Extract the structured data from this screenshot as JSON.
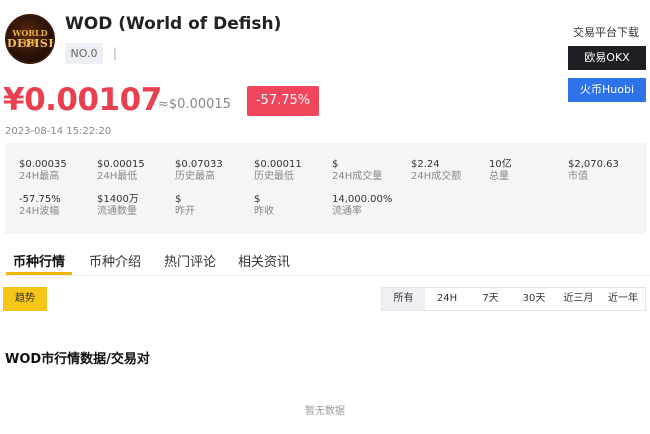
{
  "coin": {
    "logo_text_line1": "WORLD OF",
    "logo_text_line2": "DEFISH",
    "title": "WOD (World of Defish)",
    "rank": "NO.0",
    "separator": "|"
  },
  "download": {
    "title": "交易平台下载",
    "okx_label": "欧易OKX",
    "huobi_label": "火币Huobi"
  },
  "price": {
    "cny": "¥0.00107",
    "usd": "≈$0.00015",
    "change": "-57.75%",
    "timestamp": "2023-08-14 15:22:20"
  },
  "stats": [
    {
      "value": "$0.00035",
      "label": "24H最高"
    },
    {
      "value": "$0.00015",
      "label": "24H最低"
    },
    {
      "value": "$0.07033",
      "label": "历史最高"
    },
    {
      "value": "$0.00011",
      "label": "历史最低"
    },
    {
      "value": "$",
      "label": "24H成交量"
    },
    {
      "value": "$2.24",
      "label": "24H成交额"
    },
    {
      "value": "10亿",
      "label": "总量"
    },
    {
      "value": "$2,070.63",
      "label": "市值"
    },
    {
      "value": "-57.75%",
      "label": "24H波幅"
    },
    {
      "value": "$1400万",
      "label": "流通数量"
    },
    {
      "value": "$",
      "label": "昨开"
    },
    {
      "value": "$",
      "label": "昨收"
    },
    {
      "value": "14,000.00%",
      "label": "流通率"
    }
  ],
  "tabs": [
    "币种行情",
    "币种介绍",
    "热门评论",
    "相关资讯"
  ],
  "trend_label": "趋势",
  "ranges": [
    "所有",
    "24H",
    "7天",
    "30天",
    "近三月",
    "近一年"
  ],
  "section_title": "WOD市行情数据/交易对",
  "empty_text": "暂无数据",
  "colors": {
    "price_red": "#e8404f",
    "accent_yellow": "#f5c518",
    "huobi_blue": "#2e73e9",
    "okx_black": "#1e1f24"
  }
}
